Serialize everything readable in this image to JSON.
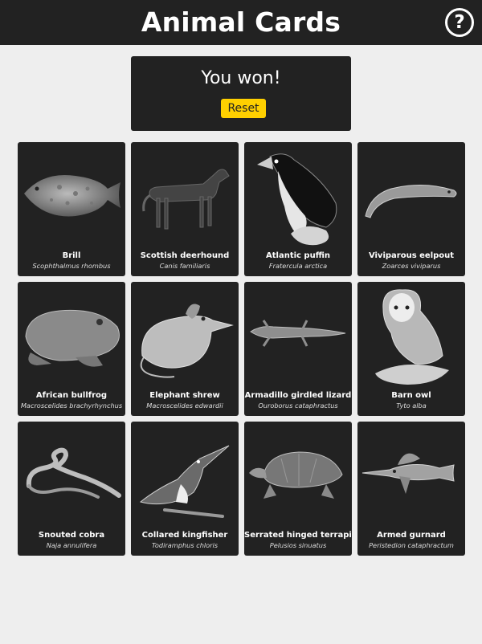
{
  "header": {
    "title": "Animal Cards",
    "help_label": "?"
  },
  "status": {
    "message": "You won!",
    "reset_label": "Reset"
  },
  "colors": {
    "header_bg": "#222222",
    "accent": "#ffd000",
    "page_bg": "#eeeeee"
  },
  "cards": [
    {
      "name": "Brill",
      "scientific": "Scophthalmus rhombus",
      "icon": "brill-icon"
    },
    {
      "name": "Scottish deerhound",
      "scientific": "Canis familiaris",
      "icon": "deerhound-icon"
    },
    {
      "name": "Atlantic puffin",
      "scientific": "Fratercula arctica",
      "icon": "puffin-icon"
    },
    {
      "name": "Viviparous eelpout",
      "scientific": "Zoarces viviparus",
      "icon": "eelpout-icon"
    },
    {
      "name": "African bullfrog",
      "scientific": "Macroscelides brachyrhynchus",
      "icon": "bullfrog-icon"
    },
    {
      "name": "Elephant shrew",
      "scientific": "Macroscelides edwardii",
      "icon": "shrew-icon"
    },
    {
      "name": "Armadillo girdled lizard",
      "scientific": "Ouroborus cataphractus",
      "icon": "lizard-icon"
    },
    {
      "name": "Barn owl",
      "scientific": "Tyto alba",
      "icon": "owl-icon"
    },
    {
      "name": "Snouted cobra",
      "scientific": "Naja annulifera",
      "icon": "cobra-icon"
    },
    {
      "name": "Collared kingfisher",
      "scientific": "Todiramphus chloris",
      "icon": "kingfisher-icon"
    },
    {
      "name": "Serrated hinged terrapin",
      "scientific": "Pelusios sinuatus",
      "icon": "terrapin-icon"
    },
    {
      "name": "Armed gurnard",
      "scientific": "Peristedion cataphractum",
      "icon": "gurnard-icon"
    }
  ]
}
